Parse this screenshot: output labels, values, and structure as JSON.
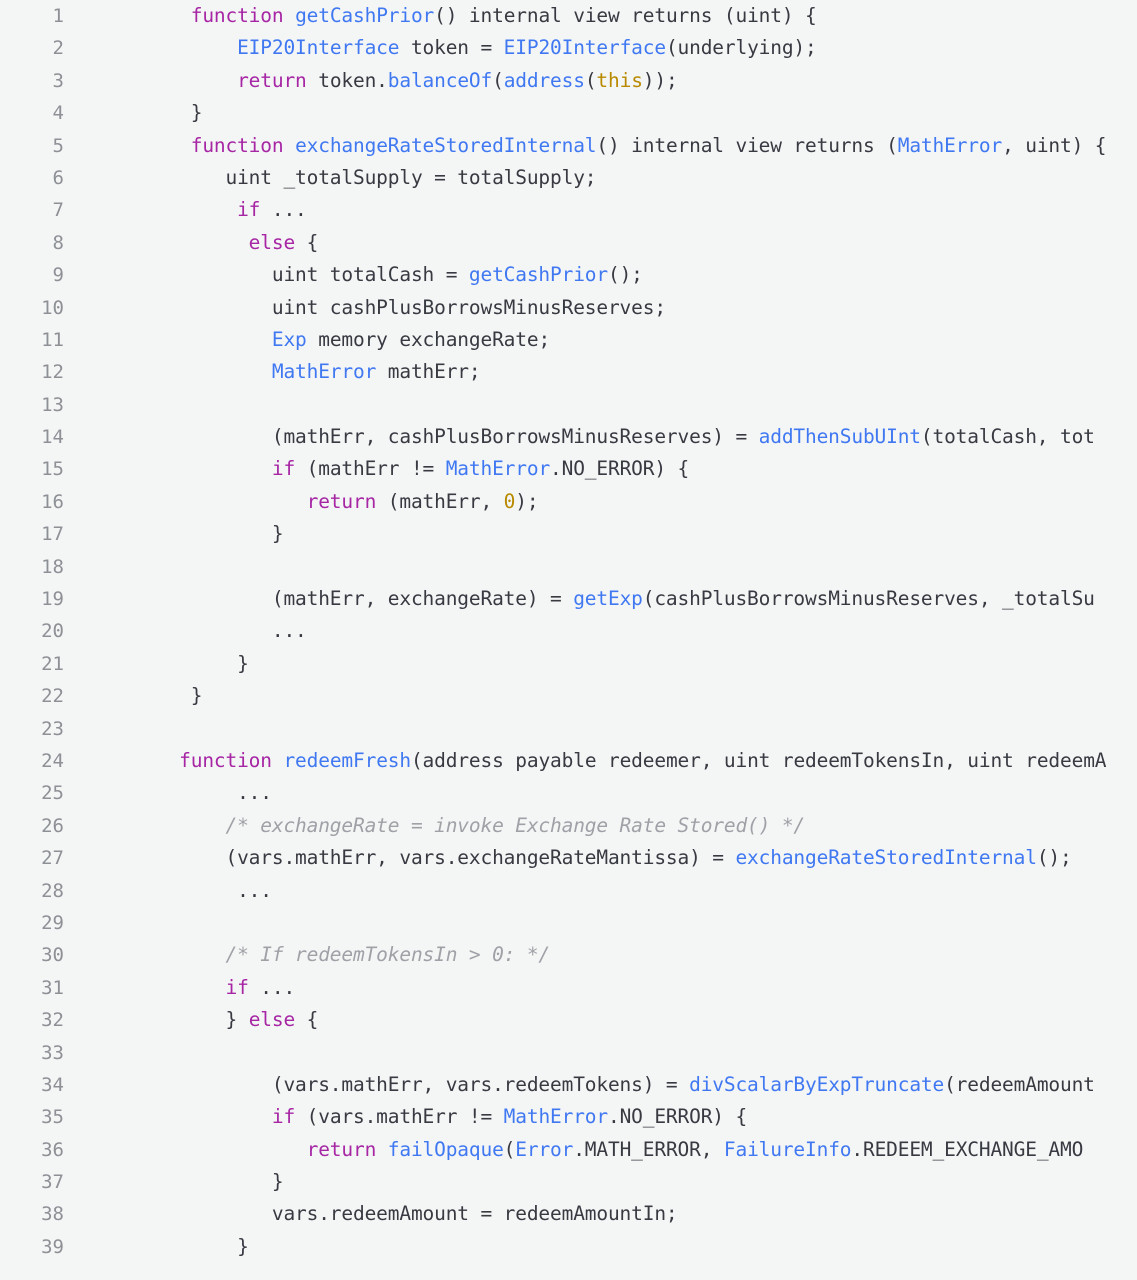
{
  "editor": {
    "language": "solidity",
    "background_color": "#f4f6f6",
    "gutter_color": "#8d9095",
    "text_color": "#383a42",
    "theme_colors": {
      "keyword": "#a626a4",
      "function": "#4078f2",
      "type": "#4078f2",
      "literal": "#b98a00",
      "comment": "#a0a1a7",
      "plain": "#383a42"
    },
    "first_line_number": 1,
    "last_line_number": 39,
    "total_visible_lines": 39
  },
  "lines": [
    {
      "num": "1",
      "tokens": [
        {
          "t": "keyword",
          "v": "function"
        },
        {
          "t": "plain",
          "v": " "
        },
        {
          "t": "func",
          "v": "getCashPrior"
        },
        {
          "t": "plain",
          "v": "() internal view returns (uint) {"
        }
      ],
      "indent": 8
    },
    {
      "num": "2",
      "tokens": [
        {
          "t": "type",
          "v": "EIP20Interface"
        },
        {
          "t": "plain",
          "v": " token = "
        },
        {
          "t": "type",
          "v": "EIP20Interface"
        },
        {
          "t": "plain",
          "v": "(underlying);"
        }
      ],
      "indent": 12
    },
    {
      "num": "3",
      "tokens": [
        {
          "t": "keyword",
          "v": "return"
        },
        {
          "t": "plain",
          "v": " token."
        },
        {
          "t": "func",
          "v": "balanceOf"
        },
        {
          "t": "plain",
          "v": "("
        },
        {
          "t": "func",
          "v": "address"
        },
        {
          "t": "plain",
          "v": "("
        },
        {
          "t": "literal",
          "v": "this"
        },
        {
          "t": "plain",
          "v": "));"
        }
      ],
      "indent": 12
    },
    {
      "num": "4",
      "tokens": [
        {
          "t": "plain",
          "v": "}"
        }
      ],
      "indent": 8
    },
    {
      "num": "5",
      "tokens": [
        {
          "t": "keyword",
          "v": "function"
        },
        {
          "t": "plain",
          "v": " "
        },
        {
          "t": "func",
          "v": "exchangeRateStoredInternal"
        },
        {
          "t": "plain",
          "v": "() internal view returns ("
        },
        {
          "t": "type",
          "v": "MathError"
        },
        {
          "t": "plain",
          "v": ", uint) {"
        }
      ],
      "indent": 8
    },
    {
      "num": "6",
      "tokens": [
        {
          "t": "plain",
          "v": "uint _totalSupply = totalSupply;"
        }
      ],
      "indent": 11
    },
    {
      "num": "7",
      "tokens": [
        {
          "t": "keyword",
          "v": "if"
        },
        {
          "t": "plain",
          "v": " ..."
        }
      ],
      "indent": 12
    },
    {
      "num": "8",
      "tokens": [
        {
          "t": "keyword",
          "v": "else"
        },
        {
          "t": "plain",
          "v": " {"
        }
      ],
      "indent": 13
    },
    {
      "num": "9",
      "tokens": [
        {
          "t": "plain",
          "v": "uint totalCash = "
        },
        {
          "t": "func",
          "v": "getCashPrior"
        },
        {
          "t": "plain",
          "v": "();"
        }
      ],
      "indent": 15
    },
    {
      "num": "10",
      "tokens": [
        {
          "t": "plain",
          "v": "uint cashPlusBorrowsMinusReserves;"
        }
      ],
      "indent": 15
    },
    {
      "num": "11",
      "tokens": [
        {
          "t": "type",
          "v": "Exp"
        },
        {
          "t": "plain",
          "v": " memory exchangeRate;"
        }
      ],
      "indent": 15
    },
    {
      "num": "12",
      "tokens": [
        {
          "t": "type",
          "v": "MathError"
        },
        {
          "t": "plain",
          "v": " mathErr;"
        }
      ],
      "indent": 15
    },
    {
      "num": "13",
      "tokens": [],
      "indent": 0
    },
    {
      "num": "14",
      "tokens": [
        {
          "t": "plain",
          "v": "(mathErr, cashPlusBorrowsMinusReserves) = "
        },
        {
          "t": "func",
          "v": "addThenSubUInt"
        },
        {
          "t": "plain",
          "v": "(totalCash, tot"
        }
      ],
      "indent": 15
    },
    {
      "num": "15",
      "tokens": [
        {
          "t": "keyword",
          "v": "if"
        },
        {
          "t": "plain",
          "v": " (mathErr != "
        },
        {
          "t": "type",
          "v": "MathError"
        },
        {
          "t": "plain",
          "v": ".NO_ERROR) {"
        }
      ],
      "indent": 15
    },
    {
      "num": "16",
      "tokens": [
        {
          "t": "keyword",
          "v": "return"
        },
        {
          "t": "plain",
          "v": " (mathErr, "
        },
        {
          "t": "literal",
          "v": "0"
        },
        {
          "t": "plain",
          "v": ");"
        }
      ],
      "indent": 18
    },
    {
      "num": "17",
      "tokens": [
        {
          "t": "plain",
          "v": "}"
        }
      ],
      "indent": 15
    },
    {
      "num": "18",
      "tokens": [],
      "indent": 0
    },
    {
      "num": "19",
      "tokens": [
        {
          "t": "plain",
          "v": "(mathErr, exchangeRate) = "
        },
        {
          "t": "func",
          "v": "getExp"
        },
        {
          "t": "plain",
          "v": "(cashPlusBorrowsMinusReserves, _totalSu"
        }
      ],
      "indent": 15
    },
    {
      "num": "20",
      "tokens": [
        {
          "t": "plain",
          "v": "..."
        }
      ],
      "indent": 15
    },
    {
      "num": "21",
      "tokens": [
        {
          "t": "plain",
          "v": "}"
        }
      ],
      "indent": 12
    },
    {
      "num": "22",
      "tokens": [
        {
          "t": "plain",
          "v": "}"
        }
      ],
      "indent": 8
    },
    {
      "num": "23",
      "tokens": [],
      "indent": 0
    },
    {
      "num": "24",
      "tokens": [
        {
          "t": "keyword",
          "v": "function"
        },
        {
          "t": "plain",
          "v": " "
        },
        {
          "t": "func",
          "v": "redeemFresh"
        },
        {
          "t": "plain",
          "v": "(address payable redeemer, uint redeemTokensIn, uint redeemA"
        }
      ],
      "indent": 7
    },
    {
      "num": "25",
      "tokens": [
        {
          "t": "plain",
          "v": "..."
        }
      ],
      "indent": 12
    },
    {
      "num": "26",
      "tokens": [
        {
          "t": "comment",
          "v": "/* exchangeRate = invoke Exchange Rate Stored() */"
        }
      ],
      "indent": 11
    },
    {
      "num": "27",
      "tokens": [
        {
          "t": "plain",
          "v": "(vars.mathErr, vars.exchangeRateMantissa) = "
        },
        {
          "t": "func",
          "v": "exchangeRateStoredInternal"
        },
        {
          "t": "plain",
          "v": "();"
        }
      ],
      "indent": 11
    },
    {
      "num": "28",
      "tokens": [
        {
          "t": "plain",
          "v": "..."
        }
      ],
      "indent": 12
    },
    {
      "num": "29",
      "tokens": [],
      "indent": 0
    },
    {
      "num": "30",
      "tokens": [
        {
          "t": "comment",
          "v": "/* If redeemTokensIn > 0: */"
        }
      ],
      "indent": 11
    },
    {
      "num": "31",
      "tokens": [
        {
          "t": "keyword",
          "v": "if"
        },
        {
          "t": "plain",
          "v": " ..."
        }
      ],
      "indent": 11
    },
    {
      "num": "32",
      "tokens": [
        {
          "t": "plain",
          "v": "} "
        },
        {
          "t": "keyword",
          "v": "else"
        },
        {
          "t": "plain",
          "v": " {"
        }
      ],
      "indent": 11
    },
    {
      "num": "33",
      "tokens": [],
      "indent": 0
    },
    {
      "num": "34",
      "tokens": [
        {
          "t": "plain",
          "v": "(vars.mathErr, vars.redeemTokens) = "
        },
        {
          "t": "func",
          "v": "divScalarByExpTruncate"
        },
        {
          "t": "plain",
          "v": "(redeemAmount"
        }
      ],
      "indent": 15
    },
    {
      "num": "35",
      "tokens": [
        {
          "t": "keyword",
          "v": "if"
        },
        {
          "t": "plain",
          "v": " (vars.mathErr != "
        },
        {
          "t": "type",
          "v": "MathError"
        },
        {
          "t": "plain",
          "v": ".NO_ERROR) {"
        }
      ],
      "indent": 15
    },
    {
      "num": "36",
      "tokens": [
        {
          "t": "keyword",
          "v": "return"
        },
        {
          "t": "plain",
          "v": " "
        },
        {
          "t": "func",
          "v": "failOpaque"
        },
        {
          "t": "plain",
          "v": "("
        },
        {
          "t": "type",
          "v": "Error"
        },
        {
          "t": "plain",
          "v": ".MATH_ERROR, "
        },
        {
          "t": "type",
          "v": "FailureInfo"
        },
        {
          "t": "plain",
          "v": ".REDEEM_EXCHANGE_AMO"
        }
      ],
      "indent": 18
    },
    {
      "num": "37",
      "tokens": [
        {
          "t": "plain",
          "v": "}"
        }
      ],
      "indent": 15
    },
    {
      "num": "38",
      "tokens": [
        {
          "t": "plain",
          "v": "vars.redeemAmount = redeemAmountIn;"
        }
      ],
      "indent": 15
    },
    {
      "num": "39",
      "tokens": [
        {
          "t": "plain",
          "v": "}"
        }
      ],
      "indent": 12
    }
  ]
}
